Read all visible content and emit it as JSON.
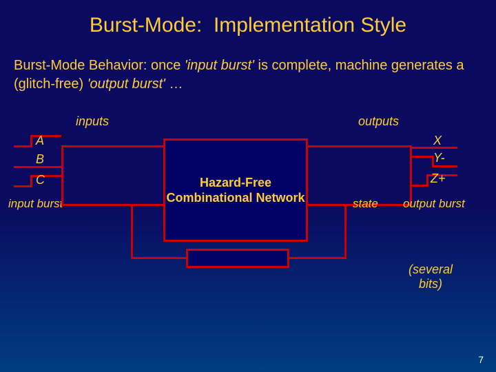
{
  "title": "Burst-Mode:  Implementation Style",
  "subtitle": {
    "prefix": "Burst-Mode Behavior:",
    "t1": " once ",
    "i1": "'input burst'",
    "t2": " is complete, machine generates a (glitch-free) ",
    "i2": "'output burst'",
    "t3": " …"
  },
  "labels": {
    "inputs": "inputs",
    "outputs": "outputs",
    "A": "A",
    "B": "B",
    "C": "C",
    "X": "X",
    "Y": "Y-",
    "Z": "Z+",
    "input_burst": "input burst",
    "output_burst": "output burst",
    "state": "state"
  },
  "box_text": "Hazard-Free Combinational Network",
  "note": "(several bits)",
  "page": "7"
}
